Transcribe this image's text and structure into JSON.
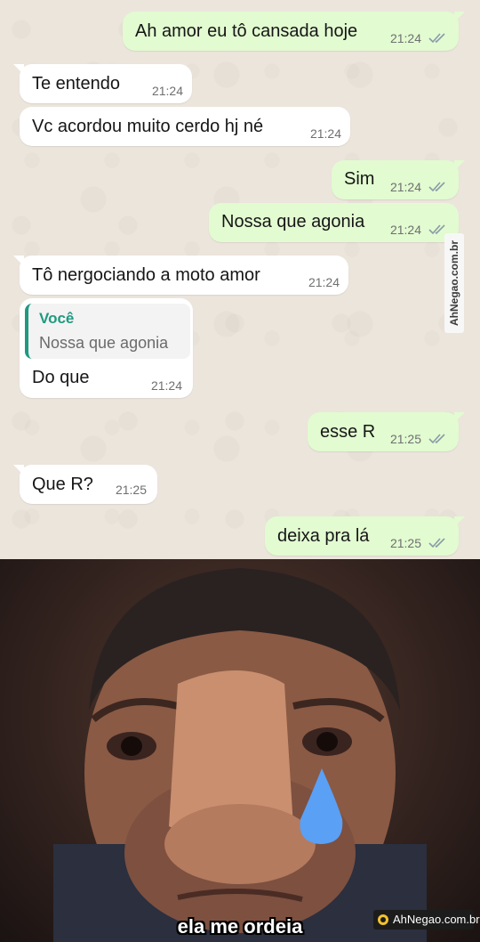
{
  "messages": [
    {
      "direction": "out",
      "text": "Ah amor eu tô cansada hoje",
      "time": "21:24"
    },
    {
      "direction": "in",
      "text": "Te entendo",
      "time": "21:24"
    },
    {
      "direction": "in",
      "text": "Vc acordou muito cerdo hj né",
      "time": "21:24"
    },
    {
      "direction": "out",
      "text": "Sim",
      "time": "21:24"
    },
    {
      "direction": "out",
      "text": "Nossa que agonia",
      "time": "21:24"
    },
    {
      "direction": "in",
      "text": "Tô nergociando a moto amor",
      "time": "21:24"
    },
    {
      "direction": "in",
      "text": "Do que",
      "time": "21:24",
      "quote": {
        "author": "Você",
        "text": "Nossa que agonia"
      }
    },
    {
      "direction": "out",
      "text": "esse R",
      "time": "21:25"
    },
    {
      "direction": "in",
      "text": "Que R?",
      "time": "21:25"
    },
    {
      "direction": "out",
      "text": "deixa pra lá",
      "time": "21:25"
    }
  ],
  "watermark_side": "AhNegao.com.br",
  "meme": {
    "caption": "ela me ordeia",
    "logo_text": "AhNegao.com.br"
  },
  "colors": {
    "outgoing_bubble": "#e2fbd1",
    "incoming_bubble": "#ffffff",
    "quote_accent": "#1f9a81",
    "read_ticks": "#8a9ba8",
    "tear": "#5aa0f5"
  },
  "icons": {
    "read_receipt": "double-check-icon",
    "logo": "ahnegao-logo-icon",
    "tear": "tear-drop-icon"
  }
}
